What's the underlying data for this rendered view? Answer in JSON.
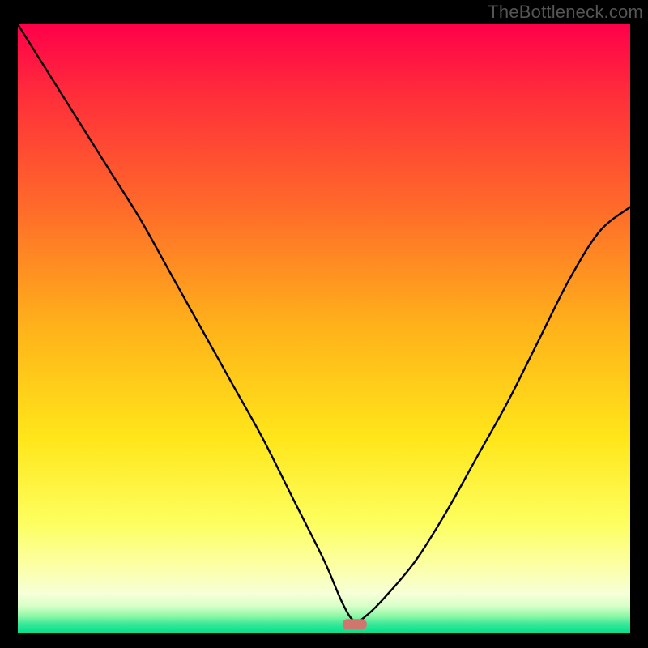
{
  "watermark": "TheBottleneck.com",
  "colors": {
    "frame": "#000000",
    "watermark": "#555555",
    "curve": "#000000",
    "marker_fill": "#d1766f",
    "gradient_stops": [
      {
        "offset": 0.0,
        "color": "#ff004a"
      },
      {
        "offset": 0.12,
        "color": "#ff2f3a"
      },
      {
        "offset": 0.3,
        "color": "#ff6a2a"
      },
      {
        "offset": 0.5,
        "color": "#ffb31a"
      },
      {
        "offset": 0.68,
        "color": "#ffe61a"
      },
      {
        "offset": 0.82,
        "color": "#fdff60"
      },
      {
        "offset": 0.9,
        "color": "#fbffb0"
      },
      {
        "offset": 0.935,
        "color": "#f6ffd8"
      },
      {
        "offset": 0.955,
        "color": "#d7ffc8"
      },
      {
        "offset": 0.972,
        "color": "#8cf7a6"
      },
      {
        "offset": 0.985,
        "color": "#35e898"
      },
      {
        "offset": 1.0,
        "color": "#00df8d"
      }
    ]
  },
  "chart_data": {
    "type": "line",
    "title": "",
    "xlabel": "",
    "ylabel": "",
    "xlim": [
      0,
      100
    ],
    "ylim": [
      0,
      100
    ],
    "grid": false,
    "marker": {
      "x": 55,
      "y": 1.5,
      "shape": "rounded-rect"
    },
    "series": [
      {
        "name": "bottleneck-curve",
        "x": [
          0,
          5,
          10,
          15,
          20,
          25,
          30,
          35,
          40,
          45,
          50,
          53,
          55,
          57,
          60,
          65,
          70,
          75,
          80,
          85,
          90,
          95,
          100
        ],
        "values": [
          100,
          92,
          84,
          76,
          68,
          59,
          50,
          41,
          32,
          22,
          12,
          5,
          2,
          3,
          6,
          12,
          20,
          29,
          38,
          48,
          58,
          66,
          70
        ]
      }
    ]
  }
}
